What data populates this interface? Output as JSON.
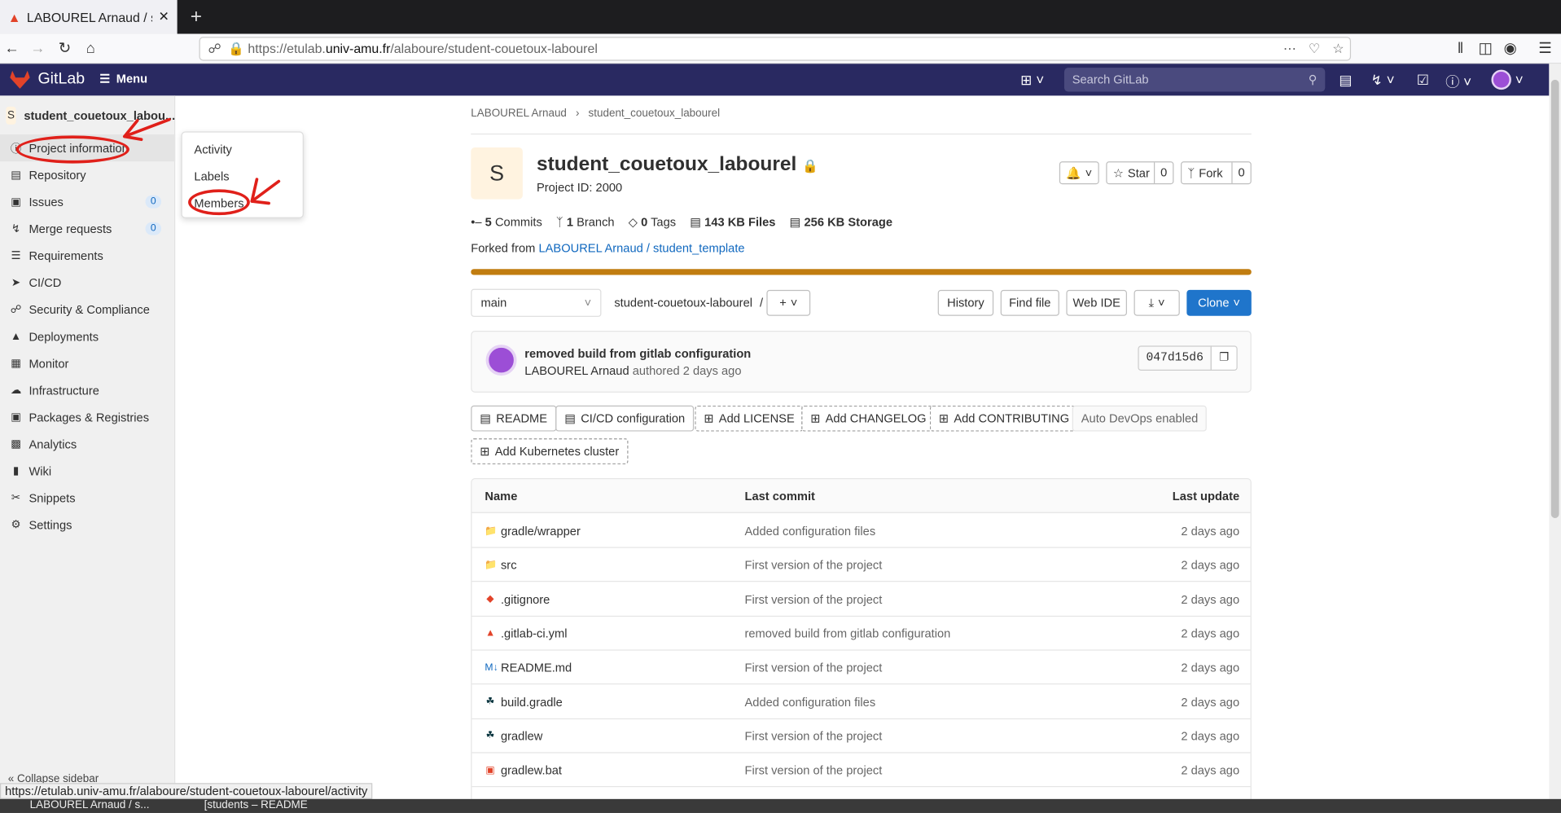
{
  "browser": {
    "tab_title": "LABOUREL Arnaud / student_couetoux_labourel",
    "url_prefix": "https://etulab.",
    "url_domain": "univ-amu.fr",
    "url_path": "/alaboure/student-couetoux-labourel",
    "status_url": "https://etulab.univ-amu.fr/alaboure/student-couetoux-labourel/activity"
  },
  "header": {
    "brand": "GitLab",
    "menu_label": "Menu",
    "search_placeholder": "Search GitLab"
  },
  "sidebar": {
    "project_initial": "S",
    "project_name": "student_couetoux_labou...",
    "items": [
      {
        "label": "Project information",
        "icon": "info-icon"
      },
      {
        "label": "Repository",
        "icon": "doc-icon"
      },
      {
        "label": "Issues",
        "icon": "issues-icon",
        "count": "0"
      },
      {
        "label": "Merge requests",
        "icon": "merge-icon",
        "count": "0"
      },
      {
        "label": "Requirements",
        "icon": "list-icon"
      },
      {
        "label": "CI/CD",
        "icon": "rocket-icon"
      },
      {
        "label": "Security & Compliance",
        "icon": "shield-icon"
      },
      {
        "label": "Deployments",
        "icon": "deploy-icon"
      },
      {
        "label": "Monitor",
        "icon": "monitor-icon"
      },
      {
        "label": "Infrastructure",
        "icon": "cloud-icon"
      },
      {
        "label": "Packages & Registries",
        "icon": "package-icon"
      },
      {
        "label": "Analytics",
        "icon": "chart-icon"
      },
      {
        "label": "Wiki",
        "icon": "book-icon"
      },
      {
        "label": "Snippets",
        "icon": "scissors-icon"
      },
      {
        "label": "Settings",
        "icon": "gear-icon"
      }
    ],
    "collapse_label": "Collapse sidebar",
    "flyout": [
      "Activity",
      "Labels",
      "Members"
    ]
  },
  "project": {
    "breadcrumb": [
      "LABOUREL Arnaud",
      "student_couetoux_labourel"
    ],
    "avatar": "S",
    "title": "student_couetoux_labourel",
    "id_text": "Project ID: 2000",
    "notify_icon": "bell-icon",
    "star_label": "Star",
    "star_count": "0",
    "fork_label": "Fork",
    "fork_count": "0",
    "stats": [
      {
        "value": "5",
        "label": "Commits"
      },
      {
        "value": "1",
        "label": "Branch"
      },
      {
        "value": "0",
        "label": "Tags"
      },
      {
        "value": "143 KB",
        "label": "Files"
      },
      {
        "value": "256 KB",
        "label": "Storage"
      }
    ],
    "forked_prefix": "Forked from",
    "forked_link": "LABOUREL Arnaud / student_template"
  },
  "repo": {
    "branch": "main",
    "path": "student-couetoux-labourel",
    "path_sep": "/",
    "buttons": {
      "history": "History",
      "find_file": "Find file",
      "web_ide": "Web IDE",
      "clone": "Clone"
    }
  },
  "commit": {
    "title": "removed build from gitlab configuration",
    "author": "LABOUREL Arnaud",
    "meta": "authored 2 days ago",
    "sha": "047d15d6"
  },
  "quick_actions": [
    "README",
    "CI/CD configuration",
    "Add LICENSE",
    "Add CHANGELOG",
    "Add CONTRIBUTING",
    "Auto DevOps enabled",
    "Add Kubernetes cluster"
  ],
  "files": {
    "headers": [
      "Name",
      "Last commit",
      "Last update"
    ],
    "rows": [
      {
        "name": "gradle/wrapper",
        "icon": "folder-icon",
        "commit": "Added configuration files",
        "updated": "2 days ago"
      },
      {
        "name": "src",
        "icon": "folder-icon",
        "commit": "First version of the project",
        "updated": "2 days ago"
      },
      {
        "name": ".gitignore",
        "icon": "git-icon",
        "commit": "First version of the project",
        "updated": "2 days ago"
      },
      {
        "name": ".gitlab-ci.yml",
        "icon": "gitlab-icon",
        "commit": "removed build from gitlab configuration",
        "updated": "2 days ago"
      },
      {
        "name": "README.md",
        "icon": "markdown-icon",
        "commit": "First version of the project",
        "updated": "2 days ago"
      },
      {
        "name": "build.gradle",
        "icon": "gradle-icon",
        "commit": "Added configuration files",
        "updated": "2 days ago"
      },
      {
        "name": "gradlew",
        "icon": "gradle-icon",
        "commit": "First version of the project",
        "updated": "2 days ago"
      },
      {
        "name": "gradlew.bat",
        "icon": "terminal-icon",
        "commit": "First version of the project",
        "updated": "2 days ago"
      }
    ]
  },
  "taskbar": {
    "items": [
      "LABOUREL Arnaud / s...",
      "[students – README"
    ]
  },
  "colors": {
    "header": "#292961",
    "accent": "#1f75cb",
    "link": "#1068bf",
    "progress": "#c17d10",
    "annotation": "#e0201a"
  }
}
